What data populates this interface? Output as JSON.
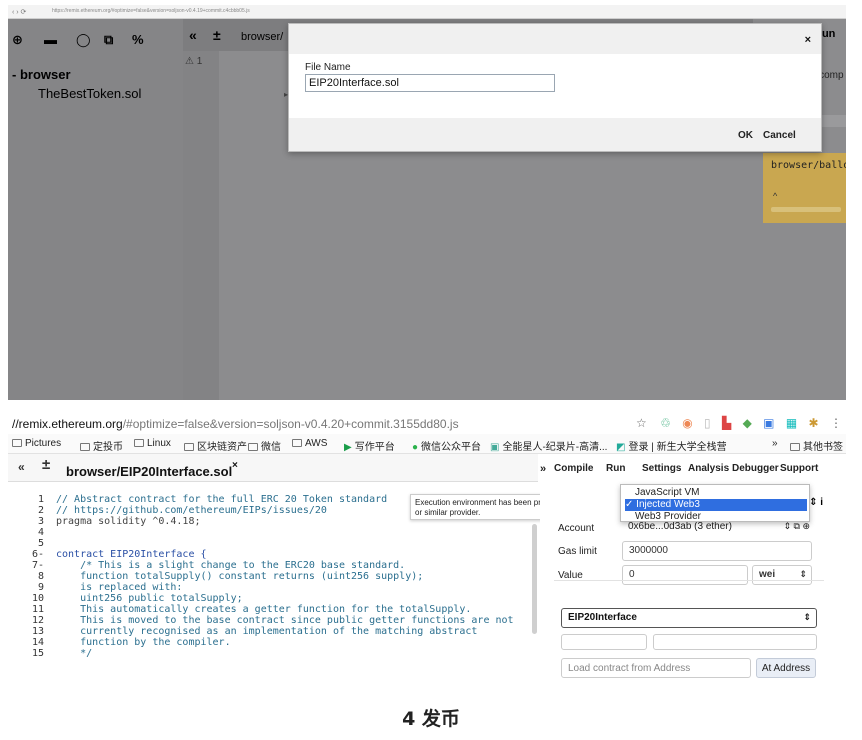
{
  "top_screenshot": {
    "browser_url": "https://remix.ethereum.org/#optimize=false&version=soljson-v0.4.19+commit.c4cbbb05.js",
    "toolbar_icons": [
      "plus-circle-icon",
      "folder-icon",
      "github-icon",
      "copy-icon",
      "link-icon"
    ],
    "editor_controls": {
      "collapse": "«",
      "plus_minus": "±",
      "tab_fragment": "browser/"
    },
    "file_tree": {
      "root": "- browser",
      "files": [
        "TheBestToken.sol"
      ]
    },
    "gutter_line": "⚠ 1",
    "right_panel": {
      "run_label": "Run",
      "to_compile": "to comp",
      "ballot_text": "browser/ballot",
      "caret": "^"
    },
    "modal": {
      "close": "×",
      "label": "File Name",
      "value": "EIP20Interface.sol",
      "ok": "OK",
      "cancel": "Cancel"
    }
  },
  "bottom_screenshot": {
    "url": {
      "host": "//remix.ethereum.org",
      "path": "/#optimize=false&version=soljson-v0.4.20+commit.3155dd80.js"
    },
    "bookmarks": [
      "Pictures",
      "定投币",
      "Linux",
      "区块链资产",
      "微信",
      "AWS",
      "写作平台",
      "微信公众平台",
      "全能星人-纪录片-高清...",
      "登录 | 新生大学全栈营",
      "其他书签"
    ],
    "editor": {
      "collapse": "«",
      "plus_minus": "±",
      "tab_name": "browser/EIP20Interface.sol",
      "tab_close": "×",
      "lines": [
        {
          "n": "1",
          "text": "// Abstract contract for the full ERC 20 Token standard"
        },
        {
          "n": "2",
          "text": "// https://github.com/ethereum/EIPs/issues/20"
        },
        {
          "n": "3",
          "text": "pragma solidity ^0.4.18;"
        },
        {
          "n": "4",
          "text": ""
        },
        {
          "n": "5",
          "text": ""
        },
        {
          "n": "6-",
          "text": "contract EIP20Interface {"
        },
        {
          "n": "7-",
          "text": "    /* This is a slight change to the ERC20 base standard."
        },
        {
          "n": "8",
          "text": "    function totalSupply() constant returns (uint256 supply);"
        },
        {
          "n": "9",
          "text": "    is replaced with:"
        },
        {
          "n": "10",
          "text": "    uint256 public totalSupply;"
        },
        {
          "n": "11",
          "text": "    This automatically creates a getter function for the totalSupply."
        },
        {
          "n": "12",
          "text": "    This is moved to the base contract since public getter functions are not"
        },
        {
          "n": "13",
          "text": "    currently recognised as an implementation of the matching abstract"
        },
        {
          "n": "14",
          "text": "    function by the compiler."
        },
        {
          "n": "15",
          "text": "    */"
        }
      ]
    },
    "tooltip": "Execution environment has been provided by Mist or similar provider.",
    "nav_tabs": [
      "Compile",
      "Run",
      "Settings",
      "Analysis",
      "Debugger",
      "Support"
    ],
    "expand_icon": "»",
    "environment_options": [
      "JavaScript VM",
      "Injected Web3",
      "Web3 Provider"
    ],
    "selected_environment": "Injected Web3",
    "account": {
      "label": "Account",
      "value": "0x6be...0d3ab (3 ether)"
    },
    "gas_limit": {
      "label": "Gas limit",
      "value": "3000000"
    },
    "value": {
      "label": "Value",
      "value": "0",
      "unit": "wei"
    },
    "contract_select": "EIP20Interface",
    "load_placeholder": "Load contract from Address",
    "at_address": "At Address"
  },
  "caption": "4 发币"
}
